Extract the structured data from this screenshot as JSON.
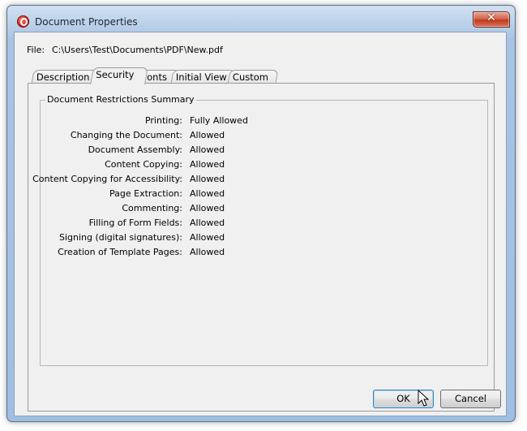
{
  "window": {
    "title": "Document Properties",
    "close_symbol": "✕"
  },
  "file": {
    "label": "File:",
    "path": "C:\\Users\\Test\\Documents\\PDF\\New.pdf"
  },
  "tabs": [
    {
      "label": "Description",
      "selected": false
    },
    {
      "label": "Security",
      "selected": true
    },
    {
      "label": "Fonts",
      "selected": false
    },
    {
      "label": "Initial View",
      "selected": false
    },
    {
      "label": "Custom",
      "selected": false
    }
  ],
  "restrictions": {
    "title": "Document Restrictions Summary",
    "rows": [
      {
        "label": "Printing:",
        "value": "Fully Allowed"
      },
      {
        "label": "Changing the Document:",
        "value": "Allowed"
      },
      {
        "label": "Document Assembly:",
        "value": "Allowed"
      },
      {
        "label": "Content Copying:",
        "value": "Allowed"
      },
      {
        "label": "Content Copying for Accessibility:",
        "value": "Allowed"
      },
      {
        "label": "Page Extraction:",
        "value": "Allowed"
      },
      {
        "label": "Commenting:",
        "value": "Allowed"
      },
      {
        "label": "Filling of Form Fields:",
        "value": "Allowed"
      },
      {
        "label": "Signing (digital signatures):",
        "value": "Allowed"
      },
      {
        "label": "Creation of Template Pages:",
        "value": "Allowed"
      }
    ]
  },
  "buttons": {
    "ok": "OK",
    "cancel": "Cancel"
  },
  "icons": {
    "app": "app-logo-icon",
    "close": "close-icon",
    "cursor": "mouse-pointer-icon"
  }
}
